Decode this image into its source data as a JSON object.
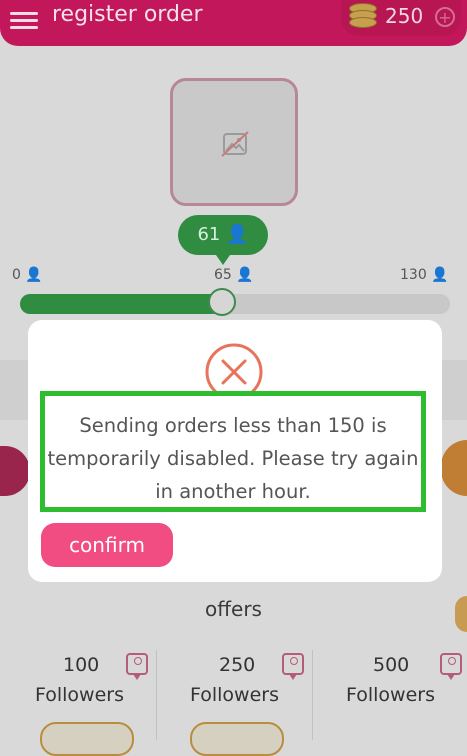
{
  "header": {
    "title": "register order",
    "coins": "250",
    "menu_icon": "hamburger-menu-icon",
    "coin_icon": "coin-stack-icon",
    "add_icon": "plus-circle-icon"
  },
  "main": {
    "image_icon": "broken-image-icon",
    "selected_bubble": "61 👤",
    "slider": {
      "min_label": "0 👤",
      "mid_label": "65 👤",
      "max_label": "130 👤",
      "min": 0,
      "max": 130,
      "value": 61,
      "color": "#2f8c41"
    },
    "offers_title": "offers",
    "offers": [
      {
        "count": "100",
        "label": "Followers"
      },
      {
        "count": "250",
        "label": "Followers"
      },
      {
        "count": "500",
        "label": "Followers"
      }
    ]
  },
  "dialog": {
    "icon": "error-x-circle-icon",
    "message": "Sending orders less than 150 is temporarily disabled. Please try again in another hour.",
    "confirm_label": "confirm",
    "accent": "#f24d82",
    "highlight": "#2ebd2e"
  }
}
